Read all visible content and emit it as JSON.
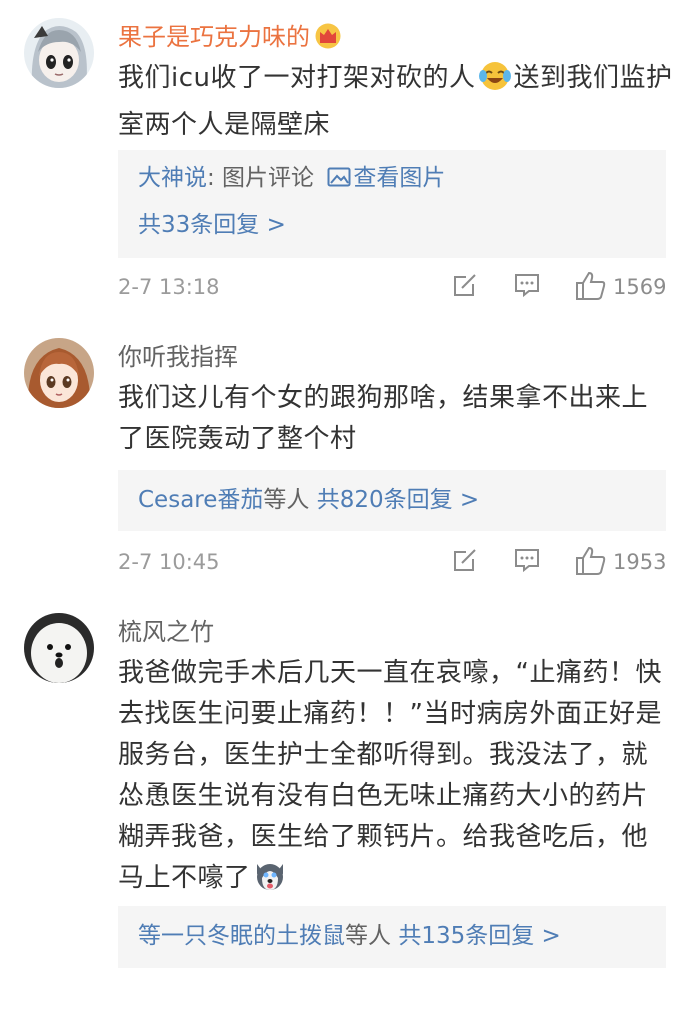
{
  "comments": [
    {
      "username": "果子是巧克力味的",
      "text_a": "我们icu收了一对打架对砍的人",
      "text_b": "送到我们监护室两个人是隔壁床",
      "replies": {
        "line1_link": "大神说",
        "line1_text": ": 图片评论 ",
        "line1_image_link": "查看图片",
        "line2_link": "共33条回复 >"
      },
      "timestamp": "2-7 13:18",
      "likes": "1569"
    },
    {
      "username": "你听我指挥",
      "text": "我们这儿有个女的跟狗那啥，结果拿不出来上了医院轰动了整个村",
      "replies": {
        "repliers_link": "Cesare番茄",
        "repliers_suffix": "等人 ",
        "count_link": "共820条回复 >"
      },
      "timestamp": "2-7 10:45",
      "likes": "1953"
    },
    {
      "username": "梳风之竹",
      "text": "我爸做完手术后几天一直在哀嚎，“止痛药！快去找医生问要止痛药！！”当时病房外面正好是服务台，医生护士全都听得到。我没法了，就怂恿医生说有没有白色无味止痛药大小的药片糊弄我爸，医生给了颗钙片。给我爸吃后，他马上不嚎了",
      "replies": {
        "repliers_link": "等一只冬眠的土拨鼠",
        "repliers_suffix": "等人 ",
        "count_link": "共135条回复 >"
      }
    }
  ],
  "icons": {
    "vip": "crown-icon",
    "emoji1": "laugh-cry-emoji",
    "emoji3": "husky-emoji",
    "repost": "repost-icon",
    "reply": "comment-icon",
    "like": "thumbs-up-icon",
    "image": "image-icon"
  },
  "colors": {
    "link": "#4f7db5",
    "vip_name": "#eb7340",
    "name": "#636363",
    "text": "#333333",
    "reply_bg": "#f5f5f5",
    "meta": "#9b9b9b"
  }
}
